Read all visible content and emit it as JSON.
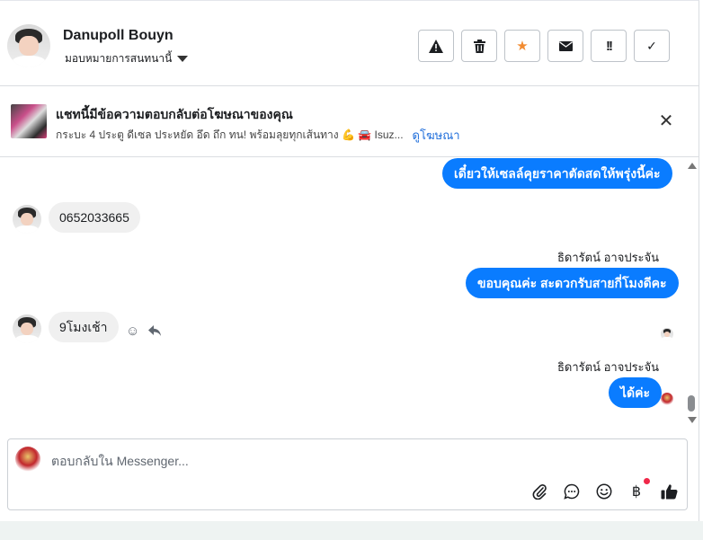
{
  "header": {
    "contact_name": "Danupoll Bouyn",
    "assign_label": "มอบหมายการสนทนานี้",
    "toolbar": [
      {
        "icon": "warning-icon",
        "glyph": "⚠"
      },
      {
        "icon": "trash-icon",
        "glyph": "🗑"
      },
      {
        "icon": "star-icon",
        "glyph": "★"
      },
      {
        "icon": "envelope-icon",
        "glyph": "✉"
      },
      {
        "icon": "exclamation-icon",
        "glyph": "!!"
      },
      {
        "icon": "check-icon",
        "glyph": "✓"
      }
    ]
  },
  "ad_banner": {
    "title": "แชทนี้มีข้อความตอบกลับต่อโฆษณาของคุณ",
    "description": "กระบะ 4 ประตู ดีเซล ประหยัด อึด ถึก ทน! พร้อมลุยทุกเส้นทาง 💪 🚘 Isuz...",
    "link_label": "ดูโฆษณา"
  },
  "messages": {
    "m1": "เดี๋ยวให้เซลล์คุยราคาตัดสดให้พรุ่งนี้ค่ะ",
    "m2": "0652033665",
    "m3_sender": "ธิดารัตน์ อาจประจัน",
    "m3": "ขอบคุณค่ะ สะดวกรับสายกี่โมงดีคะ",
    "m4": "9โมงเช้า",
    "m5_sender": "ธิดารัตน์ อาจประจัน",
    "m5": "ได้ค่ะ"
  },
  "composer": {
    "placeholder": "ตอบกลับใน Messenger..."
  },
  "colors": {
    "outgoing_bubble": "#0a7cff",
    "incoming_bubble": "#f0f0f0",
    "star_active": "#f28b30",
    "notification_dot": "#f02849"
  }
}
